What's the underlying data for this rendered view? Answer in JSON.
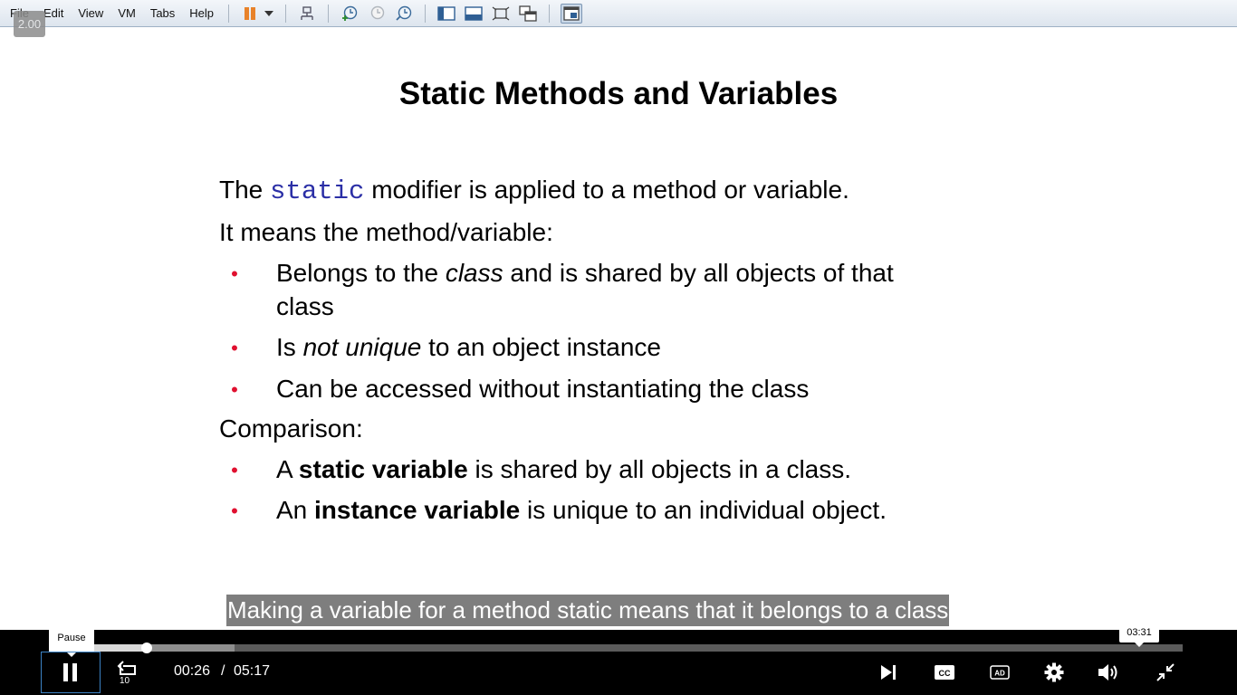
{
  "toolbar": {
    "menus": [
      "File",
      "Edit",
      "View",
      "VM",
      "Tabs",
      "Help"
    ]
  },
  "speed_badge": "2.00",
  "slide": {
    "title": "Static Methods and Variables",
    "intro_pre": "The ",
    "intro_keyword": "static",
    "intro_post": " modifier is applied to a method or variable.",
    "means": "It means the method/variable:",
    "bullet1_pre": "Belongs to the ",
    "bullet1_em": "class",
    "bullet1_post": " and is shared by all objects of that",
    "bullet1_cont": "class",
    "bullet2_pre": "Is ",
    "bullet2_em": "not unique",
    "bullet2_post": " to an object instance",
    "bullet3": "Can be accessed without instantiating the class",
    "comparison": "Comparison:",
    "bullet4_pre": "A ",
    "bullet4_strong": "static variable",
    "bullet4_post": " is shared by all objects in a class.",
    "bullet5_pre": "An ",
    "bullet5_strong": "instance variable",
    "bullet5_post": " is unique to an individual object."
  },
  "caption": "Making a variable for a method static means that it belongs to a class",
  "player": {
    "pause_tooltip": "Pause",
    "hover_time": "03:31",
    "current_time": "00:26",
    "separator": "/",
    "duration": "05:17",
    "rewind_label": "10",
    "cc_label": "CC",
    "ad_label": "AD",
    "progress_fraction": 0.082,
    "buffered_fraction": 0.16
  },
  "colors": {
    "bullet": "#e0102f",
    "keyword": "#2b2fa6",
    "focus_outline": "#3b82c4"
  }
}
